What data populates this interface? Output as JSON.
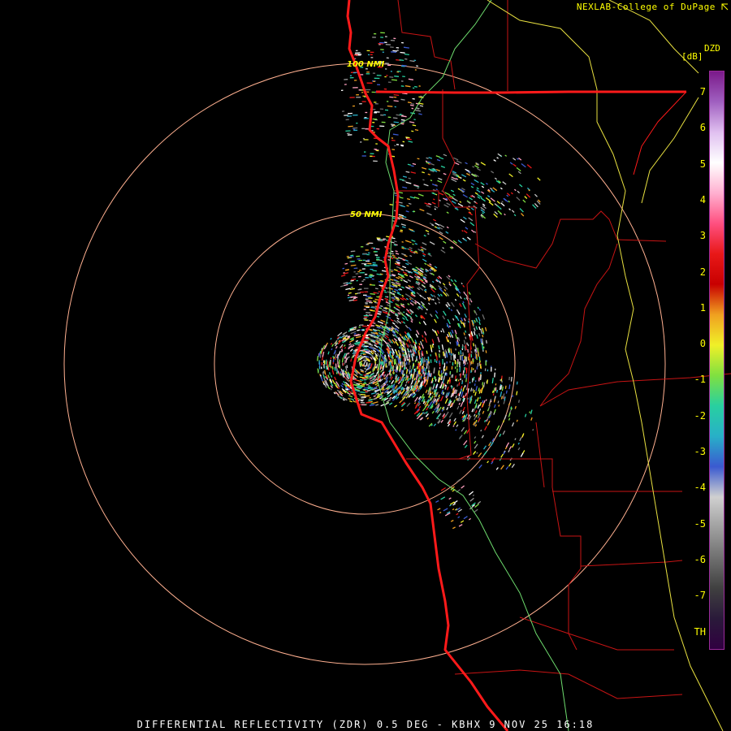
{
  "credit": "NEXLAB-College of DuPage",
  "product_line": "DIFFERENTIAL REFLECTIVITY (ZDR) 0.5 DEG - KBHX 9 NOV 25 16:18",
  "range_rings": [
    {
      "label": "50 NMI",
      "distance_nmi": 50
    },
    {
      "label": "100 NMI",
      "distance_nmi": 100
    }
  ],
  "legend": {
    "code": "DZD",
    "unit": "[dB]",
    "ticks": [
      "7",
      "6",
      "5",
      "4",
      "3",
      "2",
      "1",
      "0",
      "-1",
      "-2",
      "-3",
      "-4",
      "-5",
      "-6",
      "-7",
      "TH"
    ],
    "colors": [
      "#000000",
      "#2c0a3c",
      "#5a3a6a",
      "#6e6e6e",
      "#9a9a9a",
      "#c8c8c8",
      "#3a5ad0",
      "#28b0c8",
      "#28d0a0",
      "#80e040",
      "#f0f028",
      "#f0a020",
      "#e81818",
      "#c80000",
      "#ff4070",
      "#ffa0c0",
      "#ffffff",
      "#d0a0e0",
      "#8040a0"
    ]
  },
  "colors": {
    "range_ring": "#ffb090",
    "coastline_highway": "#ff1a1a",
    "county_lines": "#c81414",
    "state_boundary": "#e8e040",
    "hwy_green": "#6edc6e",
    "label": "#ffff00"
  }
}
